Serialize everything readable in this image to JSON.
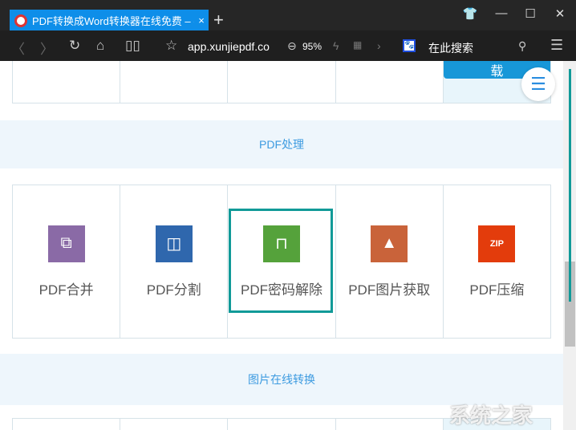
{
  "browser": {
    "tab_title": "PDF转换成Word转换器在线免费 – 在",
    "tab_close": "×",
    "new_tab": "+",
    "url": "app.xunjiepdf.co",
    "zoom": "95%",
    "search_placeholder": "在此搜索"
  },
  "top_row": {
    "download_label": "载"
  },
  "sections": [
    {
      "title": "PDF处理",
      "items": [
        {
          "label": "PDF合并",
          "color": "#8a6aa6",
          "icon": "merge-icon",
          "glyph": "⧉"
        },
        {
          "label": "PDF分割",
          "color": "#2f67ad",
          "icon": "split-icon",
          "glyph": "◫"
        },
        {
          "label": "PDF密码解除",
          "color": "#55a23b",
          "icon": "unlock-icon",
          "glyph": "🔓"
        },
        {
          "label": "PDF图片获取",
          "color": "#c9633a",
          "icon": "image-icon",
          "glyph": "▲"
        },
        {
          "label": "PDF压缩",
          "color": "#e33c0c",
          "icon": "zip-icon",
          "glyph": "ZIP"
        }
      ]
    },
    {
      "title": "图片在线转换"
    }
  ],
  "watermark": "系统之家"
}
